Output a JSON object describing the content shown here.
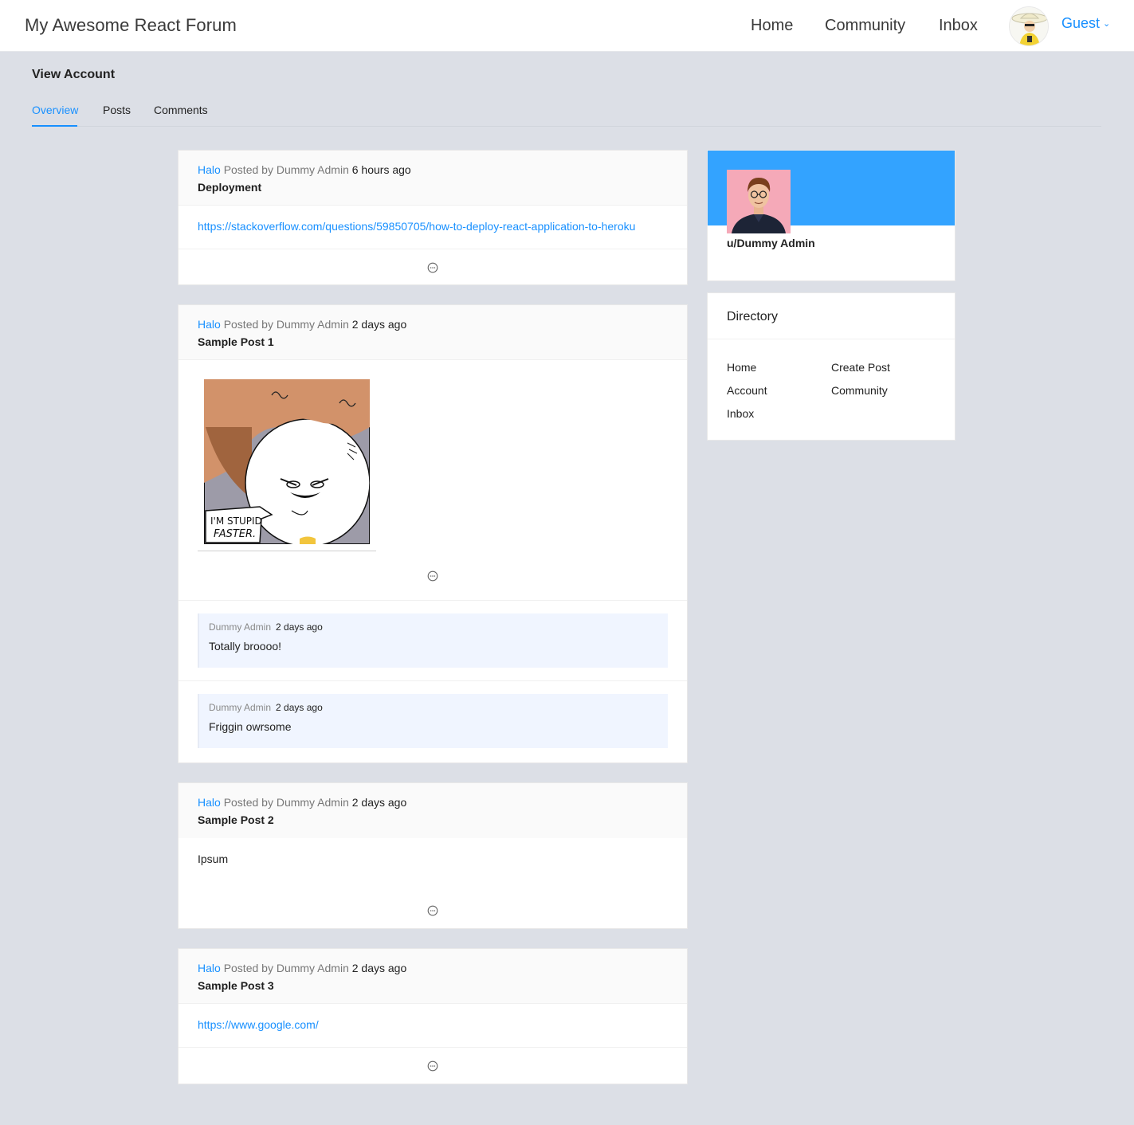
{
  "app": {
    "brand": "My Awesome React Forum",
    "nav": [
      "Home",
      "Community",
      "Inbox"
    ],
    "user_label": "Guest",
    "accent_color": "#1890ff"
  },
  "page": {
    "title": "View Account",
    "tabs": [
      "Overview",
      "Posts",
      "Comments"
    ],
    "active_tab": "Overview"
  },
  "posts": [
    {
      "community": "Halo",
      "posted_by": "Posted by Dummy Admin",
      "time": "6 hours ago",
      "title": "Deployment",
      "link": "https://stackoverflow.com/questions/59850705/how-to-deploy-react-application-to-heroku"
    },
    {
      "community": "Halo",
      "posted_by": "Posted by Dummy Admin",
      "time": "2 days ago",
      "title": "Sample Post 1",
      "image_caption": "I'M STUPID FASTER.",
      "comments": [
        {
          "author": "Dummy Admin",
          "time": "2 days ago",
          "text": "Totally broooo!"
        },
        {
          "author": "Dummy Admin",
          "time": "2 days ago",
          "text": "Friggin owrsome"
        }
      ]
    },
    {
      "community": "Halo",
      "posted_by": "Posted by Dummy Admin",
      "time": "2 days ago",
      "title": "Sample Post 2",
      "text": "Ipsum"
    },
    {
      "community": "Halo",
      "posted_by": "Posted by Dummy Admin",
      "time": "2 days ago",
      "title": "Sample Post 3",
      "link": "https://www.google.com/"
    }
  ],
  "profile": {
    "username": "u/Dummy Admin",
    "banner_color": "#33a3ff"
  },
  "directory": {
    "title": "Directory",
    "links": [
      "Home",
      "Create Post",
      "Account",
      "Community",
      "Inbox"
    ]
  }
}
